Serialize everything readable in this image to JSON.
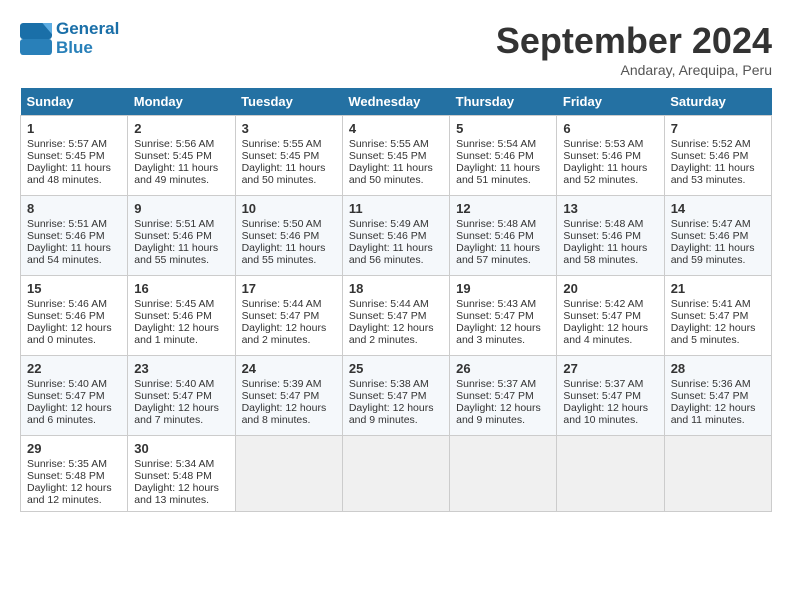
{
  "header": {
    "logo_line1": "General",
    "logo_line2": "Blue",
    "month_title": "September 2024",
    "location": "Andaray, Arequipa, Peru"
  },
  "days_of_week": [
    "Sunday",
    "Monday",
    "Tuesday",
    "Wednesday",
    "Thursday",
    "Friday",
    "Saturday"
  ],
  "weeks": [
    [
      {
        "day": 1,
        "lines": [
          "Sunrise: 5:57 AM",
          "Sunset: 5:45 PM",
          "Daylight: 11 hours",
          "and 48 minutes."
        ]
      },
      {
        "day": 2,
        "lines": [
          "Sunrise: 5:56 AM",
          "Sunset: 5:45 PM",
          "Daylight: 11 hours",
          "and 49 minutes."
        ]
      },
      {
        "day": 3,
        "lines": [
          "Sunrise: 5:55 AM",
          "Sunset: 5:45 PM",
          "Daylight: 11 hours",
          "and 50 minutes."
        ]
      },
      {
        "day": 4,
        "lines": [
          "Sunrise: 5:55 AM",
          "Sunset: 5:45 PM",
          "Daylight: 11 hours",
          "and 50 minutes."
        ]
      },
      {
        "day": 5,
        "lines": [
          "Sunrise: 5:54 AM",
          "Sunset: 5:46 PM",
          "Daylight: 11 hours",
          "and 51 minutes."
        ]
      },
      {
        "day": 6,
        "lines": [
          "Sunrise: 5:53 AM",
          "Sunset: 5:46 PM",
          "Daylight: 11 hours",
          "and 52 minutes."
        ]
      },
      {
        "day": 7,
        "lines": [
          "Sunrise: 5:52 AM",
          "Sunset: 5:46 PM",
          "Daylight: 11 hours",
          "and 53 minutes."
        ]
      }
    ],
    [
      {
        "day": 8,
        "lines": [
          "Sunrise: 5:51 AM",
          "Sunset: 5:46 PM",
          "Daylight: 11 hours",
          "and 54 minutes."
        ]
      },
      {
        "day": 9,
        "lines": [
          "Sunrise: 5:51 AM",
          "Sunset: 5:46 PM",
          "Daylight: 11 hours",
          "and 55 minutes."
        ]
      },
      {
        "day": 10,
        "lines": [
          "Sunrise: 5:50 AM",
          "Sunset: 5:46 PM",
          "Daylight: 11 hours",
          "and 55 minutes."
        ]
      },
      {
        "day": 11,
        "lines": [
          "Sunrise: 5:49 AM",
          "Sunset: 5:46 PM",
          "Daylight: 11 hours",
          "and 56 minutes."
        ]
      },
      {
        "day": 12,
        "lines": [
          "Sunrise: 5:48 AM",
          "Sunset: 5:46 PM",
          "Daylight: 11 hours",
          "and 57 minutes."
        ]
      },
      {
        "day": 13,
        "lines": [
          "Sunrise: 5:48 AM",
          "Sunset: 5:46 PM",
          "Daylight: 11 hours",
          "and 58 minutes."
        ]
      },
      {
        "day": 14,
        "lines": [
          "Sunrise: 5:47 AM",
          "Sunset: 5:46 PM",
          "Daylight: 11 hours",
          "and 59 minutes."
        ]
      }
    ],
    [
      {
        "day": 15,
        "lines": [
          "Sunrise: 5:46 AM",
          "Sunset: 5:46 PM",
          "Daylight: 12 hours",
          "and 0 minutes."
        ]
      },
      {
        "day": 16,
        "lines": [
          "Sunrise: 5:45 AM",
          "Sunset: 5:46 PM",
          "Daylight: 12 hours",
          "and 1 minute."
        ]
      },
      {
        "day": 17,
        "lines": [
          "Sunrise: 5:44 AM",
          "Sunset: 5:47 PM",
          "Daylight: 12 hours",
          "and 2 minutes."
        ]
      },
      {
        "day": 18,
        "lines": [
          "Sunrise: 5:44 AM",
          "Sunset: 5:47 PM",
          "Daylight: 12 hours",
          "and 2 minutes."
        ]
      },
      {
        "day": 19,
        "lines": [
          "Sunrise: 5:43 AM",
          "Sunset: 5:47 PM",
          "Daylight: 12 hours",
          "and 3 minutes."
        ]
      },
      {
        "day": 20,
        "lines": [
          "Sunrise: 5:42 AM",
          "Sunset: 5:47 PM",
          "Daylight: 12 hours",
          "and 4 minutes."
        ]
      },
      {
        "day": 21,
        "lines": [
          "Sunrise: 5:41 AM",
          "Sunset: 5:47 PM",
          "Daylight: 12 hours",
          "and 5 minutes."
        ]
      }
    ],
    [
      {
        "day": 22,
        "lines": [
          "Sunrise: 5:40 AM",
          "Sunset: 5:47 PM",
          "Daylight: 12 hours",
          "and 6 minutes."
        ]
      },
      {
        "day": 23,
        "lines": [
          "Sunrise: 5:40 AM",
          "Sunset: 5:47 PM",
          "Daylight: 12 hours",
          "and 7 minutes."
        ]
      },
      {
        "day": 24,
        "lines": [
          "Sunrise: 5:39 AM",
          "Sunset: 5:47 PM",
          "Daylight: 12 hours",
          "and 8 minutes."
        ]
      },
      {
        "day": 25,
        "lines": [
          "Sunrise: 5:38 AM",
          "Sunset: 5:47 PM",
          "Daylight: 12 hours",
          "and 9 minutes."
        ]
      },
      {
        "day": 26,
        "lines": [
          "Sunrise: 5:37 AM",
          "Sunset: 5:47 PM",
          "Daylight: 12 hours",
          "and 9 minutes."
        ]
      },
      {
        "day": 27,
        "lines": [
          "Sunrise: 5:37 AM",
          "Sunset: 5:47 PM",
          "Daylight: 12 hours",
          "and 10 minutes."
        ]
      },
      {
        "day": 28,
        "lines": [
          "Sunrise: 5:36 AM",
          "Sunset: 5:47 PM",
          "Daylight: 12 hours",
          "and 11 minutes."
        ]
      }
    ],
    [
      {
        "day": 29,
        "lines": [
          "Sunrise: 5:35 AM",
          "Sunset: 5:48 PM",
          "Daylight: 12 hours",
          "and 12 minutes."
        ]
      },
      {
        "day": 30,
        "lines": [
          "Sunrise: 5:34 AM",
          "Sunset: 5:48 PM",
          "Daylight: 12 hours",
          "and 13 minutes."
        ]
      },
      null,
      null,
      null,
      null,
      null
    ]
  ]
}
